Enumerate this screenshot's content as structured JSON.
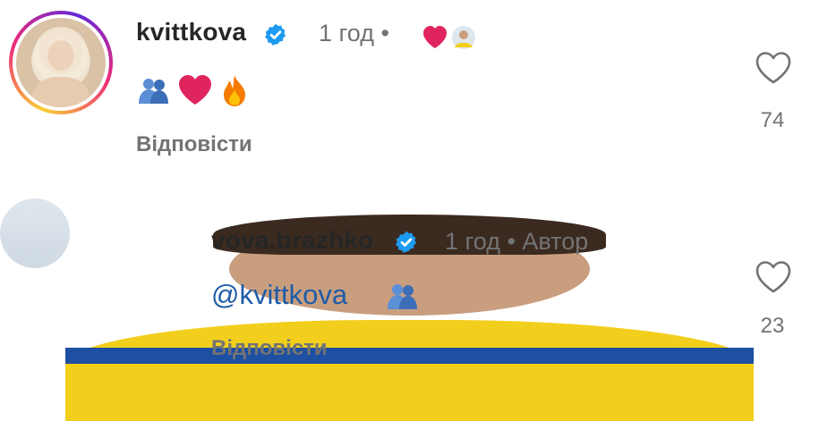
{
  "comments": [
    {
      "username": "kvittkova",
      "meta": "1 год •",
      "text": "",
      "emojis": [
        "people-hugging-icon",
        "red-heart-icon",
        "fire-icon"
      ],
      "reply_label": "Відповісти",
      "like_count": "74"
    },
    {
      "username": "vova.brazhko",
      "meta": "1 год • Автор",
      "mention": "@kvittkova",
      "emojis": [
        "people-hugging-icon"
      ],
      "reply_label": "Відповісти",
      "like_count": "23"
    }
  ],
  "colors": {
    "verified": "#1d9bf0",
    "mention": "#1d5ba8",
    "heart": "#e0245e"
  }
}
